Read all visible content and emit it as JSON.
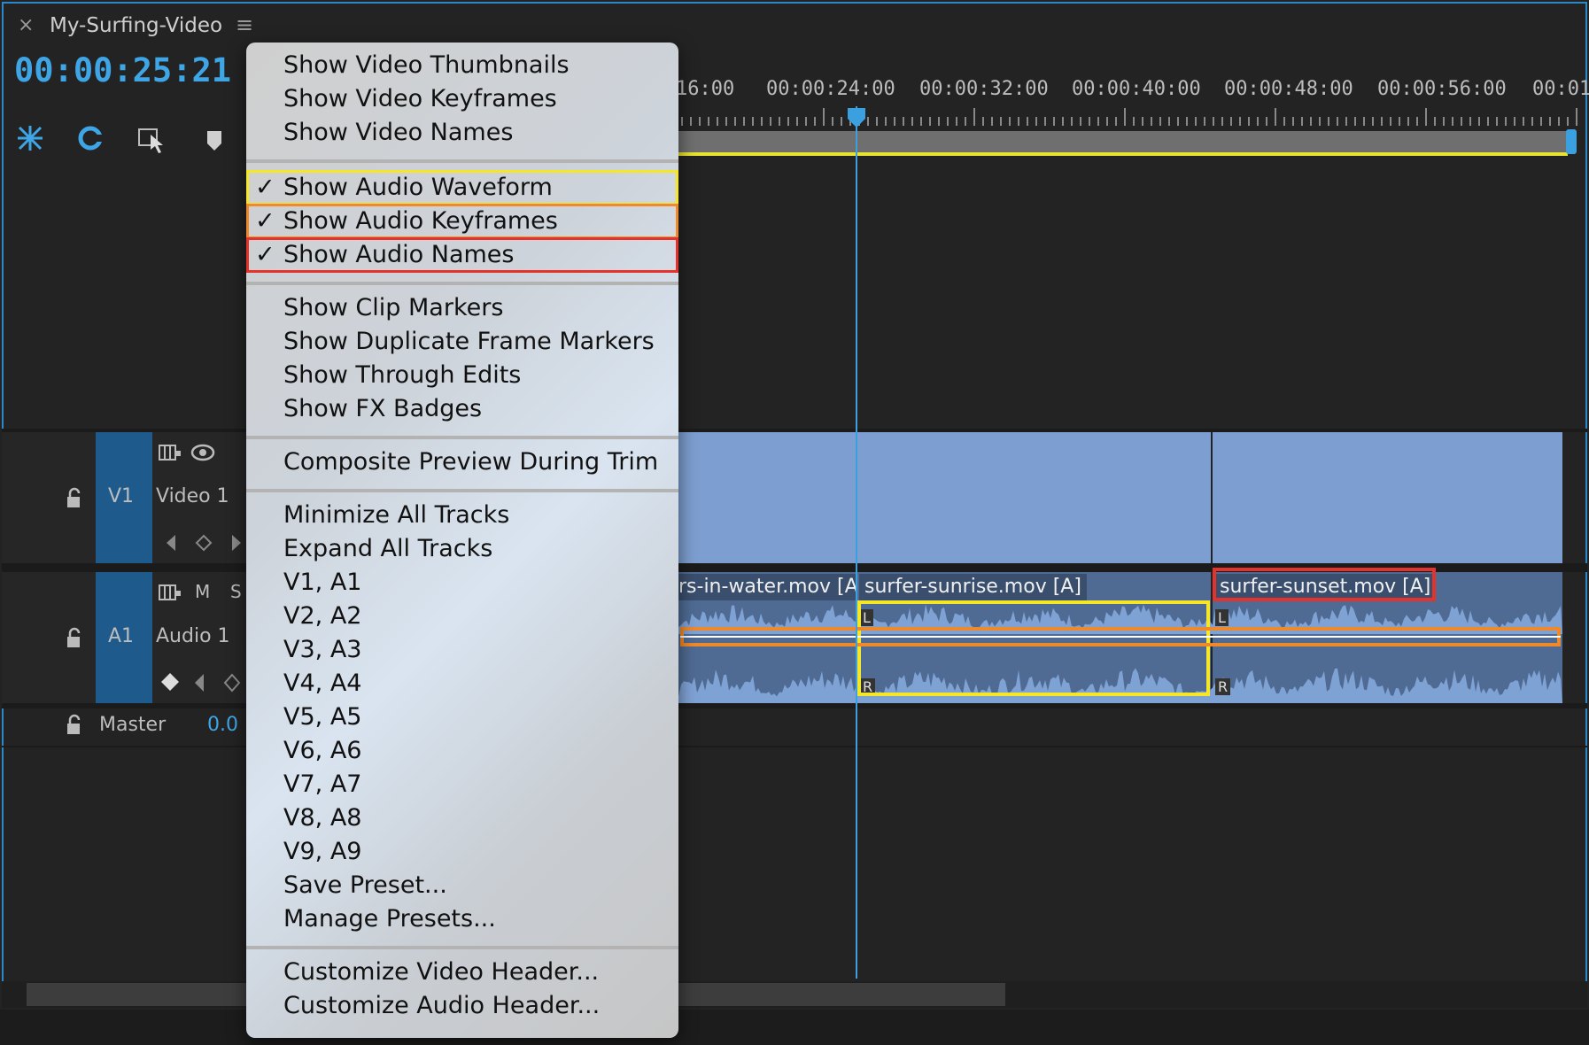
{
  "panel": {
    "title": "My-Surfing-Video",
    "timecode": "00:00:25:21",
    "close_glyph": "×",
    "menu_glyph": "≡"
  },
  "ruler": {
    "labels": [
      "16:00",
      "00:00:24:00",
      "00:00:32:00",
      "00:00:40:00",
      "00:00:48:00",
      "00:00:56:00",
      "00:01"
    ]
  },
  "tracks": {
    "v1": {
      "id": "V1",
      "name": "Video 1"
    },
    "a1": {
      "id": "A1",
      "name": "Audio 1",
      "mute": "M",
      "solo": "S"
    },
    "master": {
      "name": "Master",
      "value": "0.0"
    }
  },
  "clips": {
    "audio_1": "rs-in-water.mov [A]",
    "audio_2": "surfer-sunrise.mov [A]",
    "audio_3": "surfer-sunset.mov [A]",
    "channel_left": "L",
    "channel_right": "R"
  },
  "menu": {
    "group1": [
      "Show Video Thumbnails",
      "Show Video Keyframes",
      "Show Video Names"
    ],
    "group2": [
      "Show Audio Waveform",
      "Show Audio Keyframes",
      "Show Audio Names"
    ],
    "check": "✓",
    "group3": [
      "Show Clip Markers",
      "Show Duplicate Frame Markers",
      "Show Through Edits",
      "Show FX Badges"
    ],
    "group4": [
      "Composite Preview During Trim"
    ],
    "group5": [
      "Minimize All Tracks",
      "Expand All Tracks",
      "V1, A1",
      "V2, A2",
      "V3, A3",
      "V4, A4",
      "V5, A5",
      "V6, A6",
      "V7, A7",
      "V8, A8",
      "V9, A9",
      "Save Preset...",
      "Manage Presets..."
    ],
    "group6": [
      "Customize Video Header...",
      "Customize Audio Header..."
    ]
  },
  "colors": {
    "accent": "#3ea6e6",
    "highlight_waveform": "#f5e728",
    "highlight_keyframes": "#f0892a",
    "highlight_names": "#e5322b"
  },
  "icons": [
    "snap-icon",
    "linked-selection-icon",
    "insert-overwrite-icon",
    "add-marker-icon",
    "toggle-sync-lock-icon",
    "toggle-output-icon",
    "lock-icon",
    "keyframe-nav-icon"
  ]
}
